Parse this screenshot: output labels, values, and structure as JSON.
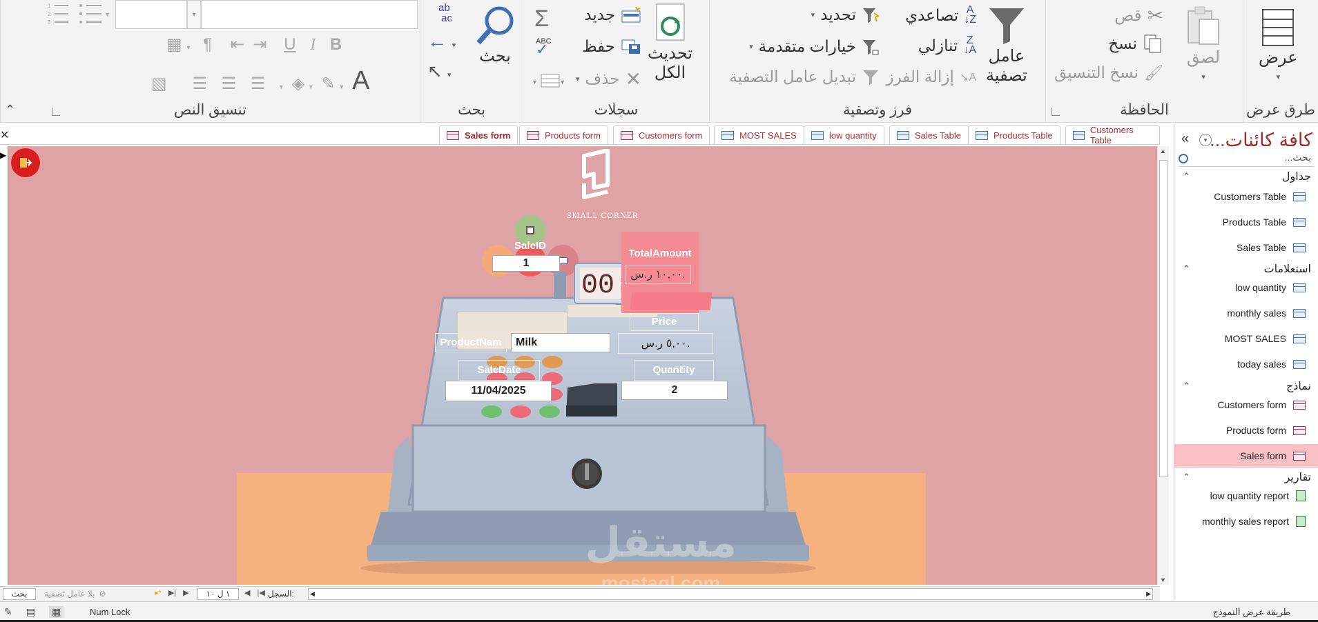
{
  "ribbon": {
    "groups": {
      "views": {
        "title": "طرق عرض",
        "view_label": "عرض"
      },
      "clipboard": {
        "title": "الحافظة",
        "paste_label": "لصق",
        "cut_label": "قص",
        "copy_label": "نسخ",
        "format_painter_label": "نسخ التنسيق"
      },
      "sort_filter": {
        "title": "فرز وتصفية",
        "filter_label_1": "عامل",
        "filter_label_2": "تصفية",
        "ascending_label": "تصاعدي",
        "descending_label": "تنازلي",
        "remove_sort_label": "إزالة الفرز",
        "selection_label": "تحديد",
        "advanced_label": "خيارات متقدمة",
        "toggle_filter_label": "تبديل عامل التصفية"
      },
      "records": {
        "title": "سجلات",
        "refresh_label_1": "تحديث",
        "refresh_label_2": "الكل",
        "new_label": "جديد",
        "save_label": "حفظ",
        "delete_label": "حذف"
      },
      "find": {
        "title": "بحث",
        "find_label": "بحث"
      },
      "text_formatting": {
        "title": "تنسيق النص"
      }
    }
  },
  "tabs": [
    {
      "label": "Customers Table",
      "type": "table"
    },
    {
      "label": "Products Table",
      "type": "table"
    },
    {
      "label": "Sales Table",
      "type": "table"
    },
    {
      "label": "low quantity",
      "type": "query"
    },
    {
      "label": "MOST SALES",
      "type": "query"
    },
    {
      "label": "Customers form",
      "type": "form"
    },
    {
      "label": "Products form",
      "type": "form"
    },
    {
      "label": "Sales form",
      "type": "form",
      "active": true
    }
  ],
  "nav": {
    "title": "كافة كائنات...",
    "search_placeholder": "بحث...",
    "categories": [
      {
        "label": "جداول",
        "items": [
          "Customers Table",
          "Products Table",
          "Sales Table"
        ]
      },
      {
        "label": "استعلامات",
        "items": [
          "low quantity",
          "monthly sales",
          "MOST SALES",
          "today sales"
        ]
      },
      {
        "label": "نماذج",
        "items": [
          "Customers form",
          "Products form",
          "Sales form"
        ]
      },
      {
        "label": "تقارير",
        "items": [
          "low quantity report",
          "monthly sales report"
        ]
      }
    ],
    "selected": "Sales form"
  },
  "form": {
    "logo_text": "SMALL CORNER",
    "clock": "00:00",
    "sale_id_label": "SaleID",
    "sale_id_value": "1",
    "total_label": "TotalAmount",
    "total_value": "١٠,٠٠ ر.س.",
    "price_label": "Price",
    "price_value": "٥,٠٠ ر.س.",
    "product_label": "ProductNam",
    "product_value": "Milk",
    "date_label": "SaleDate",
    "date_value": "11/04/2025",
    "qty_label": "Quantity",
    "qty_value": "2",
    "watermark_ar": "مستقل",
    "watermark_en": "mostaql.com"
  },
  "recnav": {
    "record_label": "السجل:",
    "record_value": "١ ل ١٠",
    "filter_label": "بلا عامل تصفية",
    "search_label": "بحث"
  },
  "status": {
    "view_text": "طريقة عرض النموذج",
    "numlock": "Num Lock"
  },
  "colors": {
    "form_bg": "#dfa3a5",
    "floor": "#f5b17e",
    "accent": "#a52a2a"
  }
}
